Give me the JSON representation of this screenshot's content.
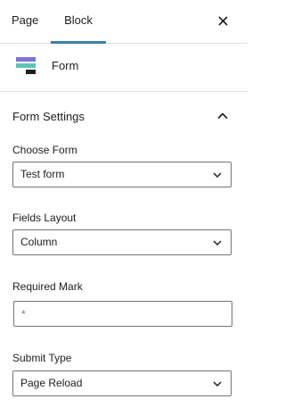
{
  "tabs": {
    "page": "Page",
    "block": "Block"
  },
  "block": {
    "title": "Form",
    "icon": "form-block-icon"
  },
  "panel": {
    "title": "Form Settings"
  },
  "fields": {
    "choose_form": {
      "label": "Choose Form",
      "value": "Test form"
    },
    "fields_layout": {
      "label": "Fields Layout",
      "value": "Column"
    },
    "required_mark": {
      "label": "Required Mark",
      "value": "*"
    },
    "submit_type": {
      "label": "Submit Type",
      "value": "Page Reload"
    }
  },
  "colors": {
    "accent": "#3a7fb0"
  }
}
